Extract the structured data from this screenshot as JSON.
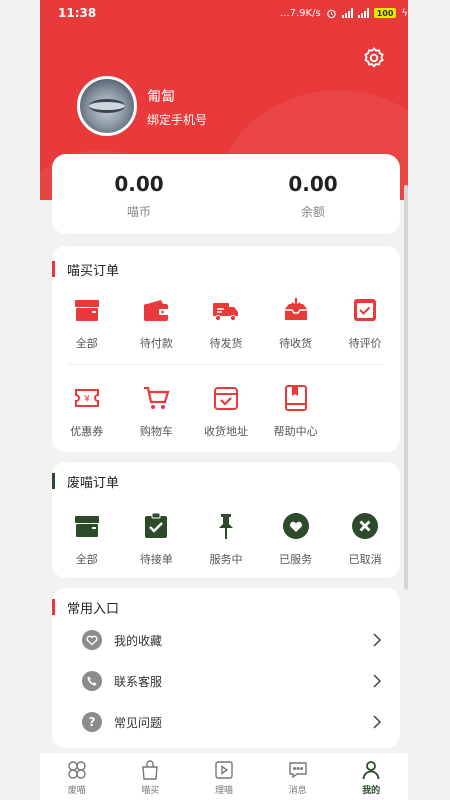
{
  "status_bar": {
    "time": "11:38",
    "speed": "...7.9K/s",
    "battery": "100"
  },
  "header": {
    "user_name": "匍匐",
    "bind_phone": "绑定手机号",
    "accent": "#e83a3a"
  },
  "balance": [
    {
      "value": "0.00",
      "label": "喵币"
    },
    {
      "value": "0.00",
      "label": "余额"
    }
  ],
  "orders": {
    "title": "喵买订单",
    "status_items": [
      {
        "label": "全部",
        "icon": "box-icon"
      },
      {
        "label": "待付款",
        "icon": "wallet-icon"
      },
      {
        "label": "待发货",
        "icon": "truck-icon"
      },
      {
        "label": "待收货",
        "icon": "inbox-icon"
      },
      {
        "label": "待评价",
        "icon": "review-icon"
      }
    ],
    "service_items": [
      {
        "label": "优惠券",
        "icon": "coupon-icon"
      },
      {
        "label": "购物车",
        "icon": "cart-icon"
      },
      {
        "label": "收货地址",
        "icon": "address-icon"
      },
      {
        "label": "帮助中心",
        "icon": "book-icon"
      }
    ]
  },
  "waste_orders": {
    "title": "废喵订单",
    "color": "#2d4a2a",
    "items": [
      {
        "label": "全部",
        "icon": "box-icon"
      },
      {
        "label": "待接单",
        "icon": "clipboard-check-icon"
      },
      {
        "label": "服务中",
        "icon": "pin-icon"
      },
      {
        "label": "已服务",
        "icon": "heart-icon"
      },
      {
        "label": "已取消",
        "icon": "cancel-icon"
      }
    ]
  },
  "common": {
    "title": "常用入口",
    "items": [
      {
        "label": "我的收藏",
        "icon": "heart-icon"
      },
      {
        "label": "联系客服",
        "icon": "phone-icon"
      },
      {
        "label": "常见问题",
        "icon": "question-icon"
      }
    ]
  },
  "bottom_nav": [
    {
      "label": "废喵",
      "icon": "clover-icon",
      "active": false
    },
    {
      "label": "喵买",
      "icon": "bag-icon",
      "active": false
    },
    {
      "label": "理喵",
      "icon": "play-icon",
      "active": false
    },
    {
      "label": "消息",
      "icon": "chat-icon",
      "active": false
    },
    {
      "label": "我的",
      "icon": "person-icon",
      "active": true
    }
  ]
}
